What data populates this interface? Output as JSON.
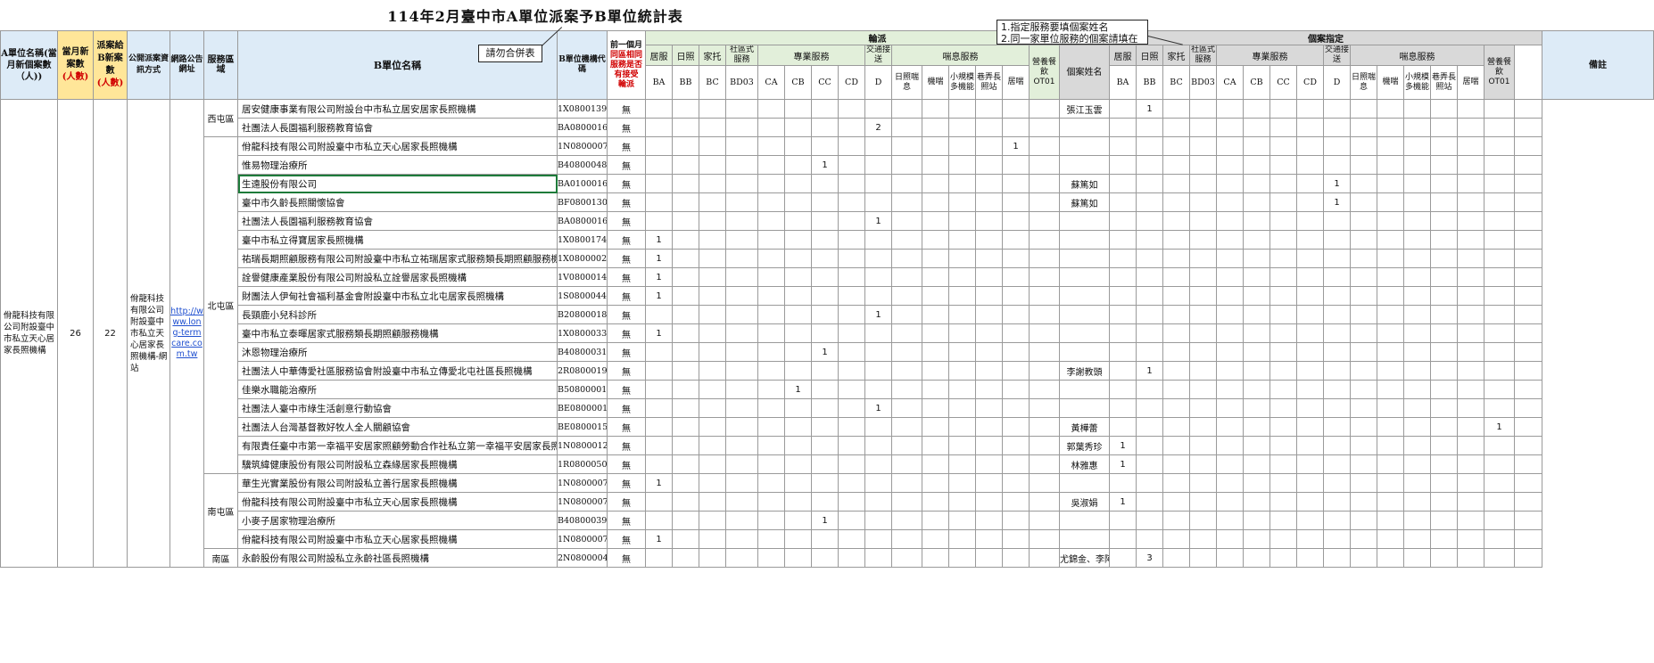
{
  "title": "114年2月臺中市A單位派案予B單位統計表",
  "comments": {
    "merge_warning": "請勿合併表",
    "note_line1": "1.指定服務要填個案姓名",
    "note_line2": "2.同一家單位服務的個案請填在"
  },
  "headers": {
    "a_unit": "A單位名稱(當月新個案數（人))",
    "new_cases_1": "當月新案數",
    "new_cases_2": "(人數)",
    "to_b_1": "派案給B新案數",
    "to_b_2": "(人數)",
    "public_method": "公開派案資訊方式",
    "web_url": "網路公告網址",
    "service_area": "服務區域",
    "b_unit_name": "B單位名稱",
    "b_code": "B單位機構代碼",
    "prev_month_1": "前一個月",
    "prev_month_2": "同區相同服務是否有接受",
    "prev_month_3": "輪派",
    "rotation": "輪派",
    "designated": "個案指定",
    "remarks": "備註",
    "case_name": "個案姓名",
    "col_labels": [
      "居服",
      "日照",
      "家托",
      "社區式服務",
      "專業服務",
      "交通接送",
      "喘息服務",
      "營養餐飲OT01"
    ],
    "respite_sub": [
      "日照喘息",
      "機喘",
      "小規模多機能",
      "巷弄長照站",
      "居喘"
    ],
    "codes": [
      "BA",
      "BB",
      "BC",
      "BD03",
      "CA",
      "CB",
      "CC",
      "CD",
      "D"
    ]
  },
  "a_unit": {
    "name": "佾龍科技有限公司附設臺中市私立天心居家長照機構",
    "new_cases": "26",
    "to_b": "22",
    "method": "佾龍科技有限公司附設臺中市私立天心居家長照機構-網站",
    "url": "http://www.long-termcare.com.tw"
  },
  "areas": [
    "西屯區",
    "北屯區",
    "南屯區",
    "南區"
  ],
  "rows": [
    {
      "name": "居安健康事業有限公司附設台中市私立居安居家長照機構",
      "code": "1X0800139",
      "prev": "無",
      "case": "張江玉雲",
      "d_bb": "1"
    },
    {
      "name": "社團法人長園福利服務教育協會",
      "code": "BA0800016",
      "prev": "無",
      "r_d": "2"
    },
    {
      "name": "佾龍科技有限公司附設臺中市私立天心居家長照機構",
      "code": "1N0800007",
      "prev": "無",
      "r_home": "1"
    },
    {
      "name": "惟易物理治療所",
      "code": "B40800048",
      "prev": "無",
      "r_cc": "1"
    },
    {
      "name": "生遠股份有限公司",
      "code": "BA0100016",
      "prev": "無",
      "case": "蘇篤如",
      "d_d": "1"
    },
    {
      "name": "臺中市久齡長照關懷協會",
      "code": "BF0800130",
      "prev": "無",
      "case": "蘇篤如",
      "d_d": "1"
    },
    {
      "name": "社團法人長園福利服務教育協會",
      "code": "BA0800016",
      "prev": "無",
      "r_d": "1"
    },
    {
      "name": "臺中市私立得寶居家長照機構",
      "code": "1X0800174",
      "prev": "無",
      "r_ba": "1"
    },
    {
      "name": "祐瑞長期照顧服務有限公司附設臺中市私立祐瑞居家式服務類長期照顧服務機構",
      "code": "1X0800002",
      "prev": "無",
      "r_ba": "1"
    },
    {
      "name": "詮譽健康產業股份有限公司附設私立詮譽居家長照機構",
      "code": "1V0800014",
      "prev": "無",
      "r_ba": "1"
    },
    {
      "name": "財團法人伊甸社會福利基金會附設臺中市私立北屯居家長照機構",
      "code": "1S0800044",
      "prev": "無",
      "r_ba": "1"
    },
    {
      "name": "長頸鹿小兒科診所",
      "code": "B20800018",
      "prev": "無",
      "r_d": "1"
    },
    {
      "name": "臺中市私立泰暉居家式服務類長期照顧服務機構",
      "code": "1X0800033",
      "prev": "無",
      "r_ba": "1"
    },
    {
      "name": "沐恩物理治療所",
      "code": "B40800031",
      "prev": "無",
      "r_cc": "1"
    },
    {
      "name": "社團法人中華傳愛社區服務協會附設臺中市私立傳愛北屯社區長照機構",
      "code": "2R0800019",
      "prev": "無",
      "case": "李謝教頭",
      "d_bb": "1"
    },
    {
      "name": "佳樂水職能治療所",
      "code": "B50800001",
      "prev": "無",
      "r_cb": "1"
    },
    {
      "name": "社團法人臺中市綠生活創意行動協會",
      "code": "BE0800001",
      "prev": "無",
      "r_d": "1"
    },
    {
      "name": "社團法人台灣基督教好牧人全人關顧協會",
      "code": "BE0800015",
      "prev": "無",
      "case": "黃樺蕾",
      "d_ot": "1"
    },
    {
      "name": "有限責任臺中市第一幸福平安居家照顧勞動合作社私立第一幸福平安居家長照機構",
      "code": "1N0800012",
      "prev": "無",
      "case": "郭葉秀珍",
      "d_ba": "1"
    },
    {
      "name": "驥筑緯健康股份有限公司附設私立森緣居家長照機構",
      "code": "1R0800050",
      "prev": "無",
      "case": "林雅惠",
      "d_ba": "1"
    },
    {
      "name": "華生光實業股份有限公司附設私立善行居家長照機構",
      "code": "1N0800007",
      "prev": "無",
      "r_ba": "1"
    },
    {
      "name": "佾龍科技有限公司附設臺中市私立天心居家長照機構",
      "code": "1N0800007",
      "prev": "無",
      "case": "吳淑娟",
      "d_ba": "1"
    },
    {
      "name": "小麥子居家物理治療所",
      "code": "B40800039",
      "prev": "無",
      "r_cc": "1"
    },
    {
      "name": "佾龍科技有限公司附設臺中市私立天心居家長照機構",
      "code": "1N0800007",
      "prev": "無",
      "r_ba": "1"
    },
    {
      "name": "永齡股份有限公司附設私立永齡社區長照機構",
      "code": "2N0800004",
      "prev": "無",
      "case": "尤錦金、李阿珍、莊國輝",
      "d_bb": "3"
    }
  ]
}
